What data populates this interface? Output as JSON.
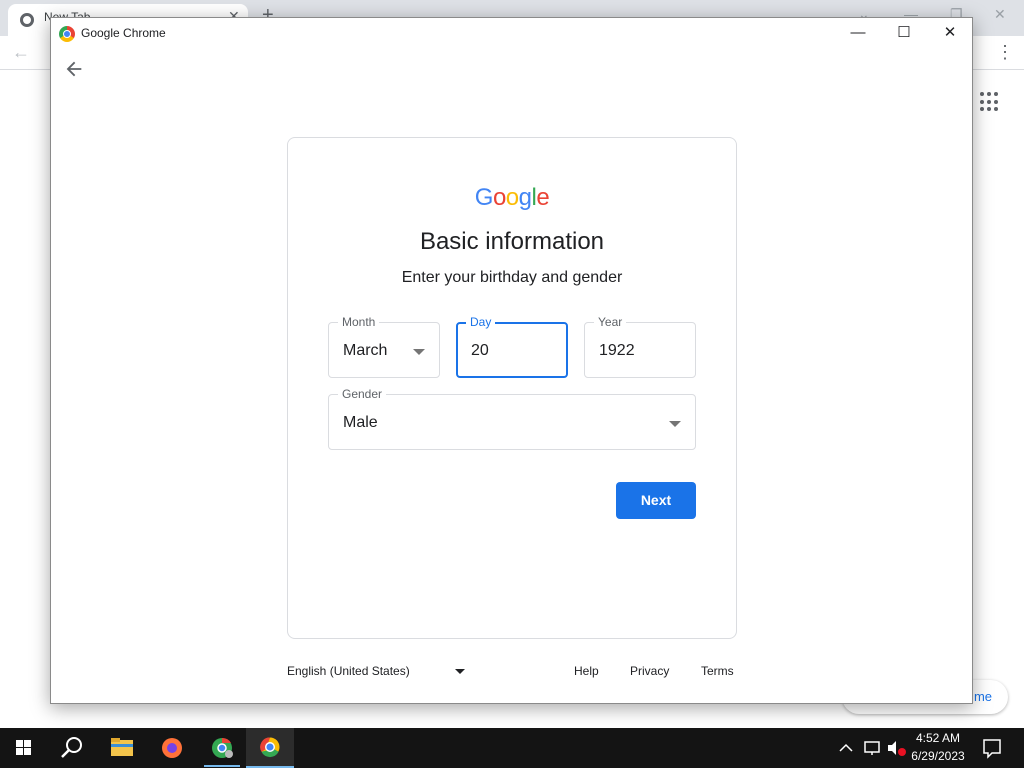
{
  "background_browser": {
    "tab_title": "New Tab",
    "pill_text": "me"
  },
  "window": {
    "title": "Google Chrome"
  },
  "card": {
    "logo_letters": [
      {
        "char": "G",
        "color": "#4285f4"
      },
      {
        "char": "o",
        "color": "#ea4335"
      },
      {
        "char": "o",
        "color": "#fbbc05"
      },
      {
        "char": "g",
        "color": "#4285f4"
      },
      {
        "char": "l",
        "color": "#34a853"
      },
      {
        "char": "e",
        "color": "#ea4335"
      }
    ],
    "title": "Basic information",
    "subtitle": "Enter your birthday and gender",
    "month": {
      "label": "Month",
      "value": "March"
    },
    "day": {
      "label": "Day",
      "value": "20"
    },
    "year": {
      "label": "Year",
      "value": "1922"
    },
    "gender": {
      "label": "Gender",
      "value": "Male"
    },
    "next_label": "Next"
  },
  "footer": {
    "language": "English (United States)",
    "help": "Help",
    "privacy": "Privacy",
    "terms": "Terms"
  },
  "taskbar": {
    "time": "4:52 AM",
    "date": "6/29/2023"
  },
  "colors": {
    "accent": "#1a73e8"
  }
}
